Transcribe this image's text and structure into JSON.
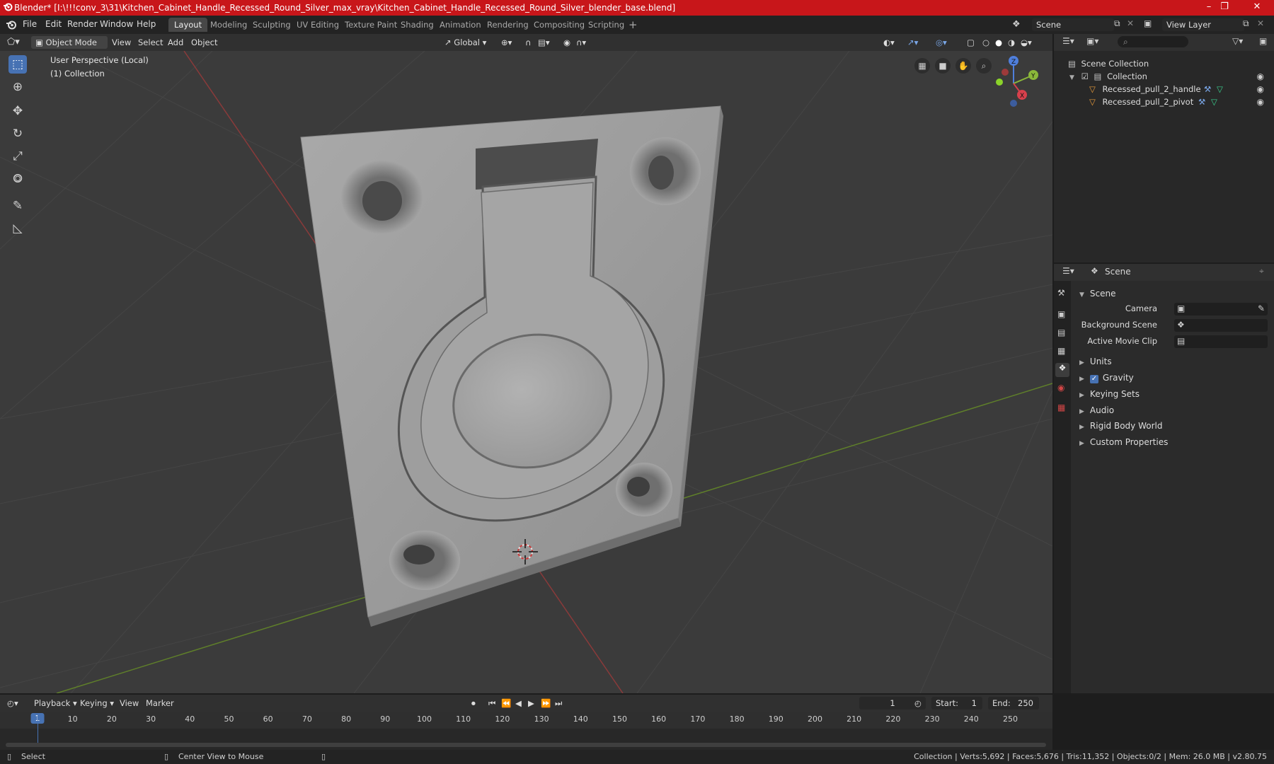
{
  "window": {
    "title": "Blender* [I:\\!!!conv_3\\31\\Kitchen_Cabinet_Handle_Recessed_Round_Silver_max_vray\\Kitchen_Cabinet_Handle_Recessed_Round_Silver_blender_base.blend]",
    "minimize": "–",
    "maximize": "❐",
    "close": "✕",
    "titlebar_color": "#c8161a"
  },
  "menubar": {
    "items": [
      "File",
      "Edit",
      "Render",
      "Window",
      "Help"
    ],
    "workspaces": [
      "Layout",
      "Modeling",
      "Sculpting",
      "UV Editing",
      "Texture Paint",
      "Shading",
      "Animation",
      "Rendering",
      "Compositing",
      "Scripting"
    ],
    "active_workspace": "Layout",
    "add_workspace": "+",
    "scene": "Scene",
    "view_layer": "View Layer"
  },
  "viewport_header": {
    "mode": "Object Mode",
    "menus": [
      "View",
      "Select",
      "Add",
      "Object"
    ],
    "orientation": "Global"
  },
  "viewport": {
    "perspective": "User Perspective (Local)",
    "collection": "(1) Collection",
    "background": "#3b3b3b",
    "gizmo_axes": [
      "Z",
      "Y",
      "X"
    ]
  },
  "tools": [
    "select-box",
    "cursor",
    "move",
    "rotate",
    "scale",
    "transform",
    "annotate",
    "measure"
  ],
  "outliner": {
    "root": "Scene Collection",
    "collection": "Collection",
    "objects": [
      "Recessed_pull_2_handle",
      "Recessed_pull_2_pivot"
    ]
  },
  "properties": {
    "context": "Scene",
    "panel_title": "Scene",
    "fields": [
      {
        "label": "Camera"
      },
      {
        "label": "Background Scene"
      },
      {
        "label": "Active Movie Clip"
      }
    ],
    "sections": [
      "Units",
      "Gravity",
      "Keying Sets",
      "Audio",
      "Rigid Body World",
      "Custom Properties"
    ],
    "gravity_checked": true
  },
  "timeline": {
    "menus": [
      "Playback",
      "Keying",
      "View",
      "Marker"
    ],
    "current_frame": "1",
    "start_label": "Start:",
    "start": "1",
    "end_label": "End:",
    "end": "250",
    "ticks": [
      "1",
      "10",
      "20",
      "30",
      "40",
      "50",
      "60",
      "70",
      "80",
      "90",
      "100",
      "110",
      "120",
      "130",
      "140",
      "150",
      "160",
      "170",
      "180",
      "190",
      "200",
      "210",
      "220",
      "230",
      "240",
      "250"
    ],
    "accent": "#4772b3"
  },
  "statusbar": {
    "left": "Select",
    "middle": "Center View to Mouse",
    "right": "Collection | Verts:5,692 | Faces:5,676 | Tris:11,352 | Objects:0/2 | Mem: 26.0 MB | v2.80.75"
  }
}
